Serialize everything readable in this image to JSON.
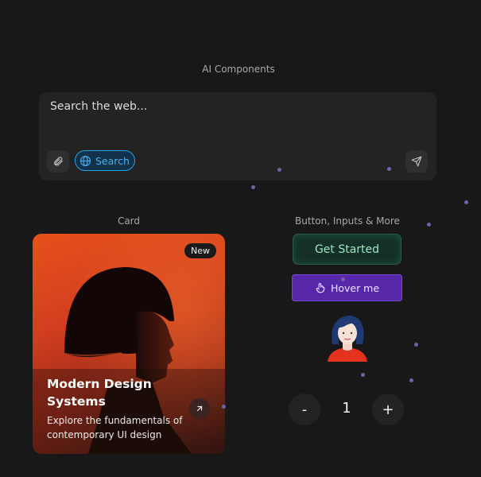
{
  "sections": {
    "ai_title": "AI Components",
    "card_title": "Card",
    "buttons_title": "Button, Inputs & More"
  },
  "search": {
    "placeholder": "Search the web...",
    "search_label": "Search",
    "icons": [
      "paperclip-icon",
      "globe-icon",
      "send-icon"
    ],
    "accent": "#2c9fe8"
  },
  "card": {
    "badge": "New",
    "title": "Modern Design Systems",
    "description": "Explore the fundamentals of contemporary UI design",
    "gradient": [
      "#e6521a",
      "#3e1a14"
    ]
  },
  "buttons": {
    "get_started": "Get Started",
    "hover_me": "Hover me"
  },
  "stepper": {
    "minus": "-",
    "value": "1",
    "plus": "+"
  }
}
